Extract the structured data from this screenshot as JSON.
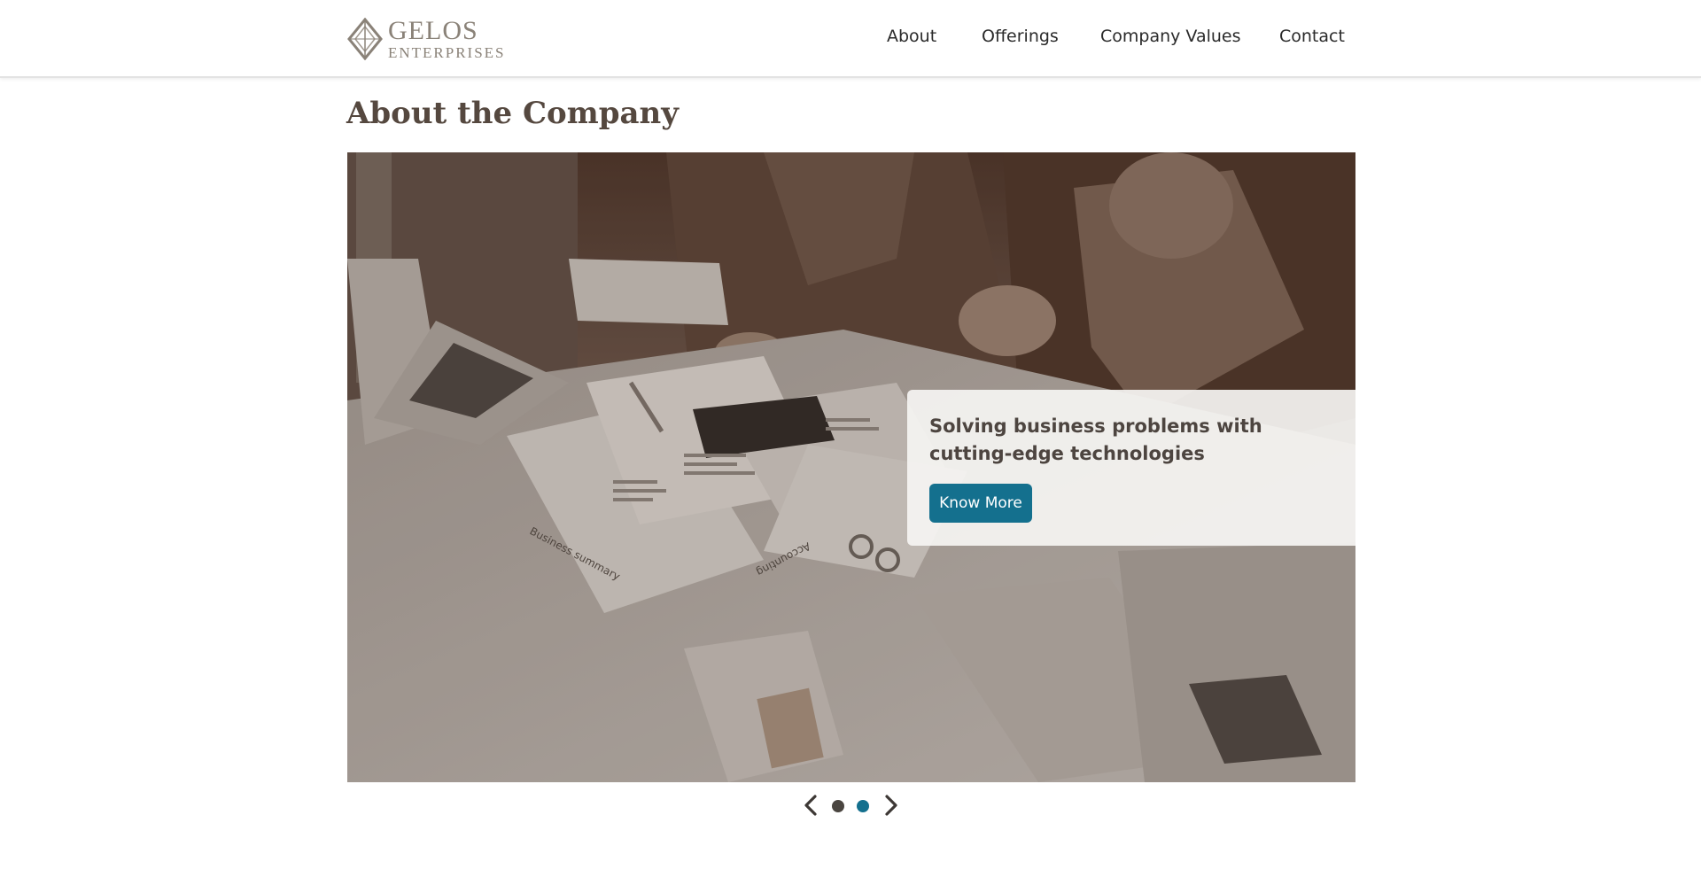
{
  "header": {
    "logo": {
      "line1": "GELOS",
      "line2": "ENTERPRISES"
    },
    "nav": [
      {
        "label": "About"
      },
      {
        "label": "Offerings"
      },
      {
        "label": "Company Values"
      },
      {
        "label": "Contact"
      }
    ]
  },
  "page": {
    "title": "About the Company"
  },
  "hero": {
    "caption": "Solving business problems with cutting-edge technologies",
    "button_label": "Know More",
    "photo_labels": {
      "business_summary": "Business summary",
      "accounting": "Accounting"
    }
  },
  "carousel": {
    "active_slide": 2,
    "total_slides": 2,
    "prev_icon": "chevron-left-icon",
    "next_icon": "chevron-right-icon"
  },
  "colors": {
    "accent": "#14708e",
    "title": "#55483f",
    "dot_inactive": "#4a4540"
  }
}
